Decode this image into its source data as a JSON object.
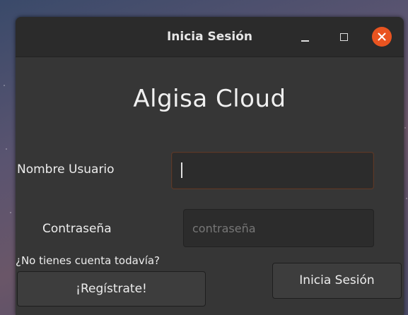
{
  "window": {
    "title": "Inicia Sesión",
    "controls": {
      "minimize_icon": "minimize-icon",
      "maximize_icon": "maximize-icon",
      "close_icon": "close-icon",
      "close_color": "#e95420"
    }
  },
  "app": {
    "title": "Algisa Cloud"
  },
  "form": {
    "username": {
      "label": "Nombre Usuario",
      "value": "",
      "placeholder": ""
    },
    "password": {
      "label": "Contraseña",
      "value": "",
      "placeholder": "contraseña"
    },
    "no_account_hint": "¿No tienes cuenta todavía?",
    "register_label": "¡Regístrate!",
    "login_label": "Inicia Sesión"
  }
}
